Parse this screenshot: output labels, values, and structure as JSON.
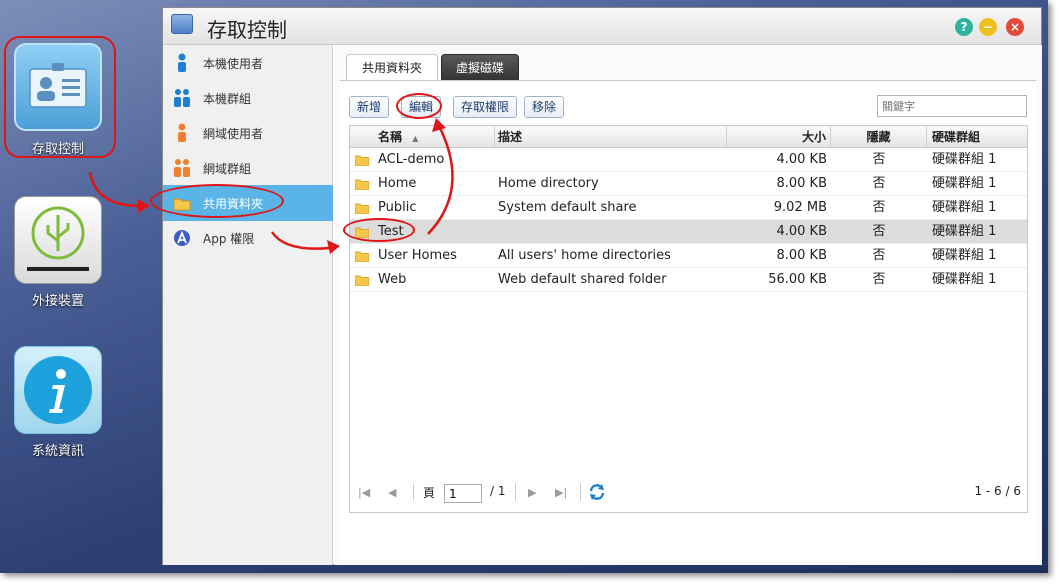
{
  "desktop": {
    "icons": [
      {
        "label": "存取控制",
        "icon": "id-card-icon"
      },
      {
        "label": "外接裝置",
        "icon": "usb-icon"
      },
      {
        "label": "系統資訊",
        "icon": "info-icon"
      }
    ]
  },
  "window": {
    "title": "存取控制",
    "controls": {
      "help": "?",
      "minimize": "−",
      "close": "×"
    },
    "colors": {
      "help": "#2fb3a0",
      "minimize": "#f0c020",
      "close": "#e24a3a",
      "accent": "#5ab4e8"
    }
  },
  "sidebar": {
    "items": [
      {
        "label": "本機使用者",
        "icon": "user-icon"
      },
      {
        "label": "本機群組",
        "icon": "group-icon"
      },
      {
        "label": "網域使用者",
        "icon": "domain-user-icon"
      },
      {
        "label": "網域群組",
        "icon": "domain-group-icon"
      },
      {
        "label": "共用資料夾",
        "icon": "folder-icon",
        "active": true
      },
      {
        "label": "App 權限",
        "icon": "app-icon"
      }
    ]
  },
  "tabs": [
    {
      "label": "共用資料夾",
      "active": true
    },
    {
      "label": "虛擬磁碟",
      "active": false
    }
  ],
  "toolbar": {
    "add": "新增",
    "edit": "編輯",
    "permissions": "存取權限",
    "remove": "移除",
    "search_placeholder": "關鍵字"
  },
  "table": {
    "columns": [
      "名稱",
      "描述",
      "大小",
      "隱藏",
      "硬碟群組"
    ],
    "sort_indicator": "▲",
    "rows": [
      {
        "name": "ACL-demo",
        "desc": "",
        "size": "4.00 KB",
        "hidden": "否",
        "volume": "硬碟群組 1"
      },
      {
        "name": "Home",
        "desc": "Home directory",
        "size": "8.00 KB",
        "hidden": "否",
        "volume": "硬碟群組 1"
      },
      {
        "name": "Public",
        "desc": "System default share",
        "size": "9.02 MB",
        "hidden": "否",
        "volume": "硬碟群組 1"
      },
      {
        "name": "Test",
        "desc": "",
        "size": "4.00 KB",
        "hidden": "否",
        "volume": "硬碟群組 1",
        "selected": true
      },
      {
        "name": "User Homes",
        "desc": "All users' home directories",
        "size": "8.00 KB",
        "hidden": "否",
        "volume": "硬碟群組 1"
      },
      {
        "name": "Web",
        "desc": "Web default shared folder",
        "size": "56.00 KB",
        "hidden": "否",
        "volume": "硬碟群組 1"
      }
    ]
  },
  "pager": {
    "page_label": "頁",
    "page_value": "1",
    "total": "/ 1",
    "range": "1 - 6 / 6"
  }
}
